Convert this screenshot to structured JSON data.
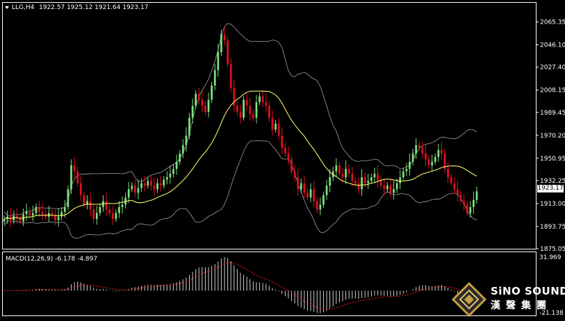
{
  "main_panel": {
    "header": {
      "symbol_timeframe": "LLG,H4",
      "ohlc": "1922.57 1925.12 1921.64 1923.17"
    },
    "price_axis_labels": [
      "2065.35",
      "2046.10",
      "2027.40",
      "2008.15",
      "1989.45",
      "1970.20",
      "1950.95",
      "1932.25",
      "1913.00",
      "1893.75",
      "1875.05"
    ],
    "current_price": "1923.17"
  },
  "macd_panel": {
    "header": "MACD(12,26,9) -6.178 -4.897",
    "axis_top": "31.969",
    "axis_bottom": "-21.138"
  },
  "watermark": {
    "brand": "SiNO SOUND",
    "brand_cn": "漢聲集團"
  },
  "colors": {
    "background": "#000000",
    "bull_candle": "#7ee07e",
    "bear_candle": "#e01020",
    "bands": "#a0a0a0",
    "ma": "#ffff66",
    "macd_hist": "#d0d0d0",
    "macd_signal": "#ff2020"
  },
  "chart_data": {
    "type": "candlestick",
    "title": "LLG,H4",
    "ylim": [
      1875.05,
      2075
    ],
    "closes": [
      1900,
      1902,
      1899,
      1903,
      1901,
      1898,
      1904,
      1906,
      1903,
      1905,
      1910,
      1906,
      1904,
      1902,
      1905,
      1903,
      1899,
      1902,
      1906,
      1910,
      1925,
      1945,
      1940,
      1930,
      1920,
      1912,
      1915,
      1908,
      1900,
      1905,
      1910,
      1915,
      1908,
      1905,
      1900,
      1905,
      1910,
      1912,
      1918,
      1925,
      1928,
      1922,
      1926,
      1930,
      1928,
      1932,
      1928,
      1925,
      1930,
      1928,
      1933,
      1935,
      1938,
      1942,
      1948,
      1955,
      1962,
      1970,
      1985,
      1995,
      2005,
      2000,
      1995,
      1990,
      2000,
      2012,
      2025,
      2040,
      2055,
      2050,
      2030,
      2010,
      1995,
      1990,
      1985,
      2000,
      1995,
      1988,
      1985,
      1998,
      2003,
      1998,
      1995,
      1985,
      1975,
      1980,
      1970,
      1960,
      1955,
      1950,
      1940,
      1935,
      1925,
      1930,
      1922,
      1918,
      1925,
      1915,
      1908,
      1912,
      1920,
      1928,
      1935,
      1940,
      1945,
      1938,
      1935,
      1942,
      1938,
      1932,
      1930,
      1925,
      1935,
      1930,
      1932,
      1935,
      1938,
      1932,
      1928,
      1925,
      1928,
      1922,
      1925,
      1930,
      1935,
      1940,
      1942,
      1948,
      1955,
      1962,
      1960,
      1955,
      1950,
      1945,
      1948,
      1952,
      1958,
      1955,
      1942,
      1935,
      1930,
      1925,
      1920,
      1915,
      1912,
      1905,
      1910,
      1916,
      1923.17
    ]
  }
}
